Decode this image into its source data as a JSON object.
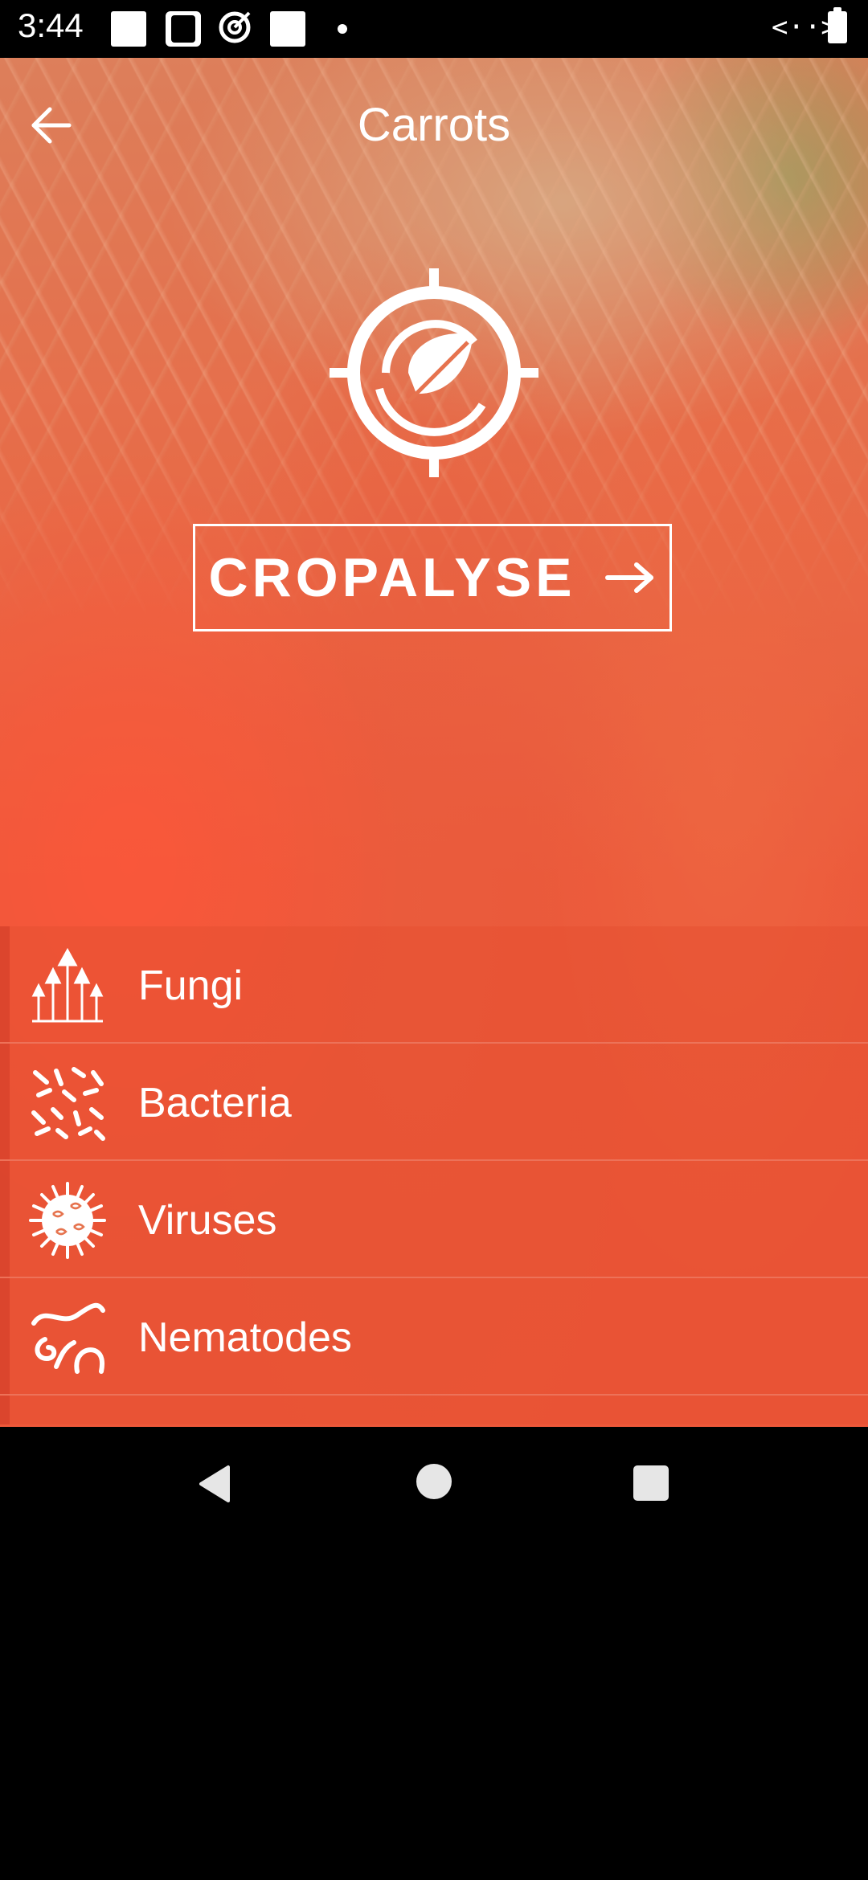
{
  "status_bar": {
    "time": "3:44",
    "data_indicator": "<··>!"
  },
  "toolbar": {
    "title": "Carrots",
    "back_icon": "arrow-left-icon"
  },
  "logo": {
    "icon": "crosshair-leaf-icon"
  },
  "cropalyse_button": {
    "label": "CROPALYSE",
    "icon": "arrow-right-icon"
  },
  "pathogen_list": {
    "items": [
      {
        "label": "Fungi",
        "icon": "fungi-icon"
      },
      {
        "label": "Bacteria",
        "icon": "bacteria-icon"
      },
      {
        "label": "Viruses",
        "icon": "virus-icon"
      },
      {
        "label": "Nematodes",
        "icon": "nematode-icon"
      },
      {
        "label": "",
        "icon": "insect-icon"
      }
    ]
  },
  "nav_bar": {
    "back": "nav-back-icon",
    "home": "nav-home-icon",
    "recents": "nav-recents-icon"
  },
  "colors": {
    "overlay": "#ec5a3c",
    "text": "#ffffff",
    "system_bar": "#000000"
  }
}
